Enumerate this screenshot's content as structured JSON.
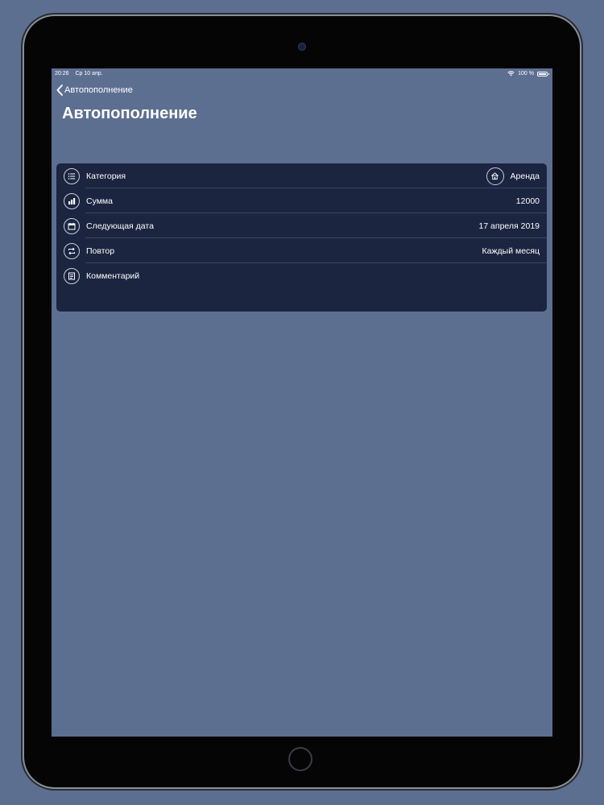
{
  "status_bar": {
    "time": "20:26",
    "date": "Ср 10 апр.",
    "battery": "100 %"
  },
  "nav": {
    "back_label": "Автопополнение"
  },
  "page": {
    "title": "Автопополнение"
  },
  "form": {
    "rows": [
      {
        "label": "Категория",
        "value": "Аренда",
        "icon": "list-icon",
        "value_icon": "house-icon"
      },
      {
        "label": "Сумма",
        "value": "12000",
        "icon": "coins-icon"
      },
      {
        "label": "Следующая дата",
        "value": "17 апреля 2019",
        "icon": "calendar-icon"
      },
      {
        "label": "Повтор",
        "value": "Каждый месяц",
        "icon": "repeat-icon"
      },
      {
        "label": "Комментарий",
        "value": "",
        "icon": "note-icon"
      }
    ]
  },
  "colors": {
    "background": "#5d6f91",
    "card": "#1b2540",
    "text": "#ffffff"
  }
}
